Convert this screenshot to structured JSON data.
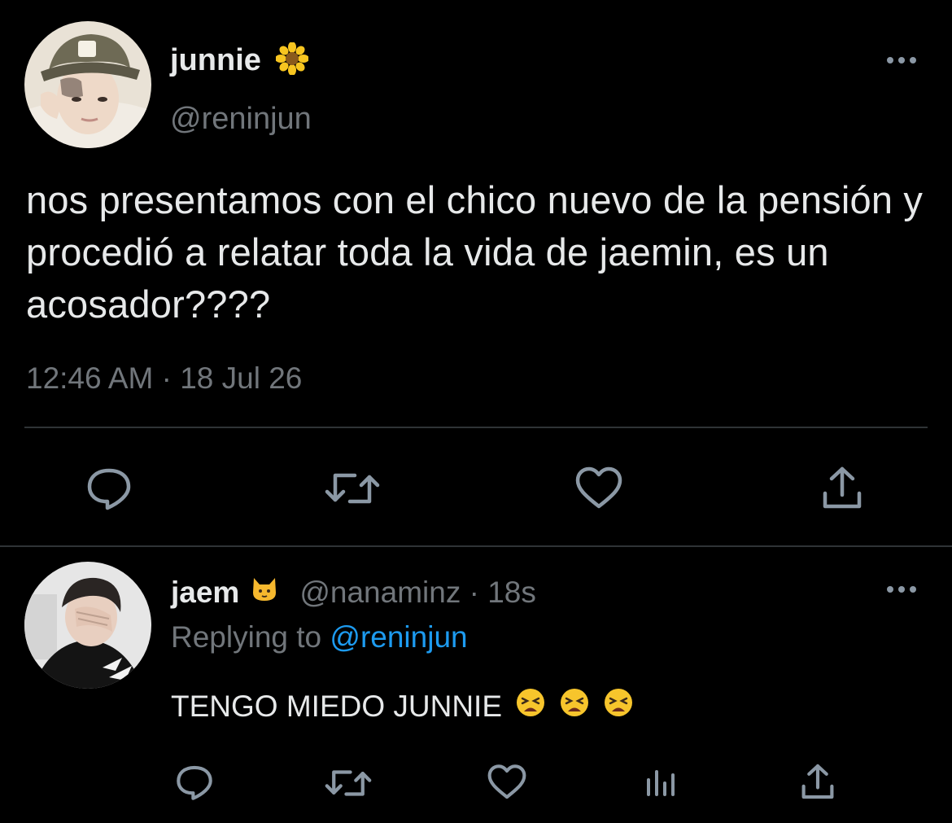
{
  "main_tweet": {
    "display_name": "junnie",
    "name_emoji": "sunflower-icon",
    "handle": "@reninjun",
    "text": "nos presentamos con el chico nuevo de la pensión y procedió a relatar toda la vida de jaemin, es un acosador????",
    "timestamp": "12:46 AM · 18 Jul 26"
  },
  "reply_tweet": {
    "display_name": "jaem",
    "name_emoji": "cat-face-icon",
    "handle_time": "@nanaminz · 18s",
    "replying_prefix": "Replying to",
    "replying_mention": "@reninjun",
    "text": "TENGO MIEDO JUNNIE",
    "text_emojis": [
      "tired-face-icon",
      "tired-face-icon",
      "tired-face-icon"
    ]
  },
  "colors": {
    "background": "#000000",
    "text_primary": "#e7e9ea",
    "text_secondary": "#71767b",
    "link": "#1d9bf0",
    "divider": "#2f3336",
    "icon": "#8b98a5"
  }
}
